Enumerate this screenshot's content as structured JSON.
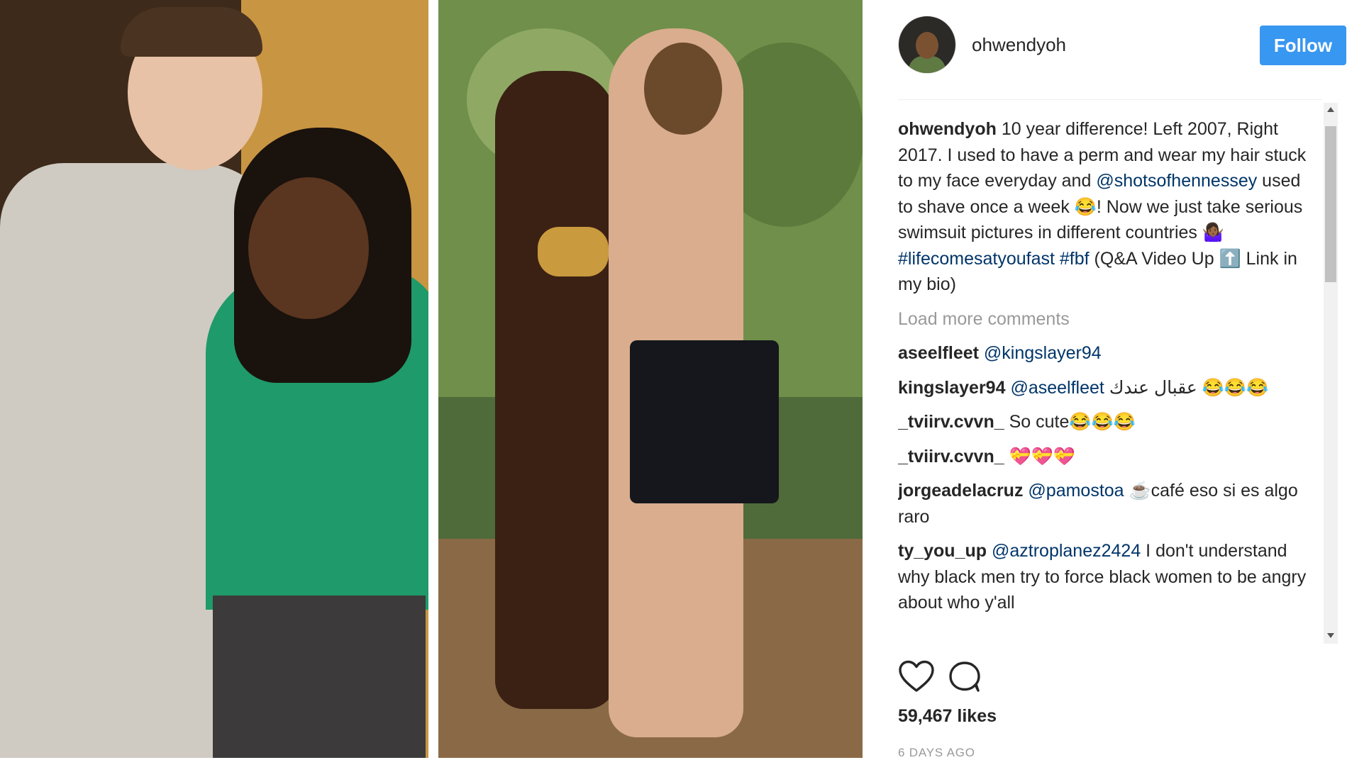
{
  "post": {
    "username": "ohwendyoh",
    "follow_label": "Follow",
    "caption": {
      "author": "ohwendyoh",
      "part1": " 10 year difference! Left 2007, Right 2017. I used to have a perm and wear my hair stuck to my face everyday and ",
      "mention": "@shotsofhennessey",
      "part2": " used to shave once a week 😂! Now we just take serious swimsuit pictures in different countries 🤷🏾‍♀️ ",
      "tag1": "#lifecomesatyoufast",
      "space": " ",
      "tag2": "#fbf",
      "part3": " (Q&A Video Up ⬆️ Link in my bio)"
    },
    "load_more": "Load more comments",
    "comments": [
      {
        "user": "aseelfleet",
        "mention": "@kingslayer94",
        "text": ""
      },
      {
        "user": "kingslayer94",
        "mention": "@aseelfleet",
        "text": " عقبال عندك 😂😂😂"
      },
      {
        "user": "_tviirv.cvvn_",
        "mention": "",
        "text": " So cute😂😂😂"
      },
      {
        "user": "_tviirv.cvvn_",
        "mention": "",
        "text": " 💝💝💝"
      },
      {
        "user": "jorgeadelacruz",
        "mention": "@pamostoa",
        "text": " ☕café eso si es algo raro"
      },
      {
        "user": "ty_you_up",
        "mention": "@aztroplanez2424",
        "text": " I don't understand why black men try to force black women to be angry about who y'all"
      }
    ],
    "likes": "59,467 likes",
    "age": "6 DAYS AGO",
    "icons": {
      "like": "heart-outline-icon",
      "comment": "comment-bubble-icon"
    },
    "colors": {
      "follow_button": "#3897f0",
      "link": "#003569",
      "muted": "#999999"
    }
  }
}
